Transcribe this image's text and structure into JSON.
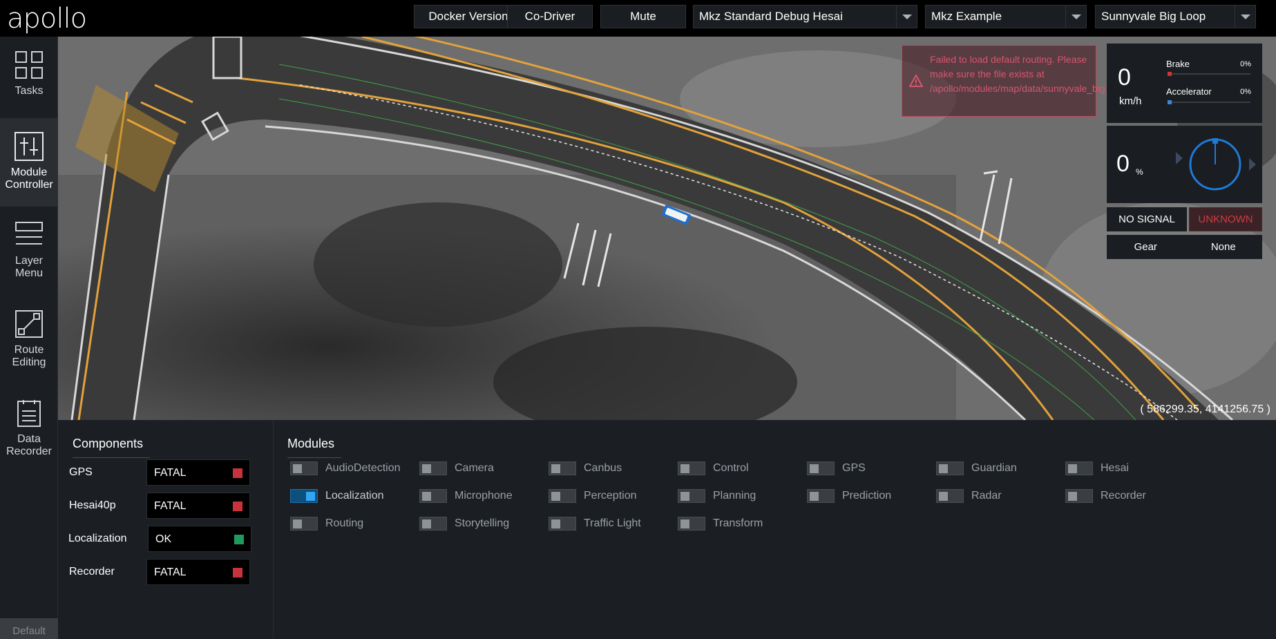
{
  "header": {
    "logo": "apollo",
    "buttons": {
      "docker": "Docker Version",
      "codriver": "Co-Driver",
      "mute": "Mute"
    },
    "selects": {
      "mode": "Mkz Standard Debug Hesai",
      "vehicle": "Mkz Example",
      "map": "Sunnyvale Big Loop"
    }
  },
  "sidebar": {
    "items": [
      {
        "label": "Tasks",
        "icon": "grid-icon"
      },
      {
        "label": "Module\nController",
        "icon": "sliders-icon"
      },
      {
        "label": "Layer\nMenu",
        "icon": "layers-icon"
      },
      {
        "label": "Route\nEditing",
        "icon": "route-icon"
      },
      {
        "label": "Data\nRecorder",
        "icon": "document-icon"
      }
    ],
    "footer": "Default"
  },
  "map": {
    "coordinates": "( 586299.35, 4141256.75 )",
    "alert": "Failed to load default routing. Please make sure the file exists at /apollo/modules/map/data/sunnyvale_big_loop_default_cycle_routing.txt"
  },
  "dashboard": {
    "speed": "0",
    "speed_unit": "km/h",
    "brake_label": "Brake",
    "brake_pct": "0%",
    "brake_level": 0,
    "accel_label": "Accelerator",
    "accel_pct": "0%",
    "accel_level": 0,
    "steering_pct": "0",
    "steering_unit": "%",
    "signal": "NO SIGNAL",
    "driving_mode": "UNKNOWN",
    "gear_label": "Gear",
    "gear_value": "None",
    "colors": {
      "brake": "#d0343a",
      "accel": "#3788d8",
      "unknown": "#d03b45"
    }
  },
  "components": {
    "title": "Components",
    "items": [
      {
        "name": "GPS",
        "status": "FATAL",
        "color": "#c8323a"
      },
      {
        "name": "Hesai40p",
        "status": "FATAL",
        "color": "#c8323a"
      },
      {
        "name": "Localization",
        "status": "OK",
        "color": "#1f9a5c"
      },
      {
        "name": "Recorder",
        "status": "FATAL",
        "color": "#c8323a"
      }
    ]
  },
  "modules": {
    "title": "Modules",
    "items": [
      {
        "name": "AudioDetection",
        "on": false
      },
      {
        "name": "Camera",
        "on": false
      },
      {
        "name": "Canbus",
        "on": false
      },
      {
        "name": "Control",
        "on": false
      },
      {
        "name": "GPS",
        "on": false
      },
      {
        "name": "Guardian",
        "on": false
      },
      {
        "name": "Hesai",
        "on": false
      },
      {
        "name": "Localization",
        "on": true
      },
      {
        "name": "Microphone",
        "on": false
      },
      {
        "name": "Perception",
        "on": false
      },
      {
        "name": "Planning",
        "on": false
      },
      {
        "name": "Prediction",
        "on": false
      },
      {
        "name": "Radar",
        "on": false
      },
      {
        "name": "Recorder",
        "on": false
      },
      {
        "name": "Routing",
        "on": false
      },
      {
        "name": "Storytelling",
        "on": false
      },
      {
        "name": "Traffic Light",
        "on": false
      },
      {
        "name": "Transform",
        "on": false
      }
    ]
  }
}
